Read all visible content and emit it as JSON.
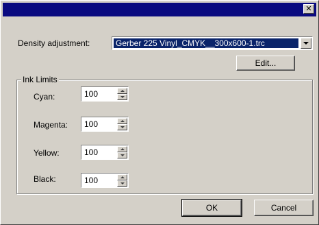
{
  "titlebar": {
    "close_glyph": "✕"
  },
  "density": {
    "label": "Density adjustment:",
    "value": "Gerber 225 Vinyl_CMYK__300x600-1.trc",
    "edit_label": "Edit..."
  },
  "ink_limits": {
    "title": "Ink Limits",
    "cyan": {
      "label": "Cyan:",
      "value": "100"
    },
    "magenta": {
      "label": "Magenta:",
      "value": "100"
    },
    "yellow": {
      "label": "Yellow:",
      "value": "100"
    },
    "black": {
      "label": "Black:",
      "value": "100"
    }
  },
  "buttons": {
    "ok": "OK",
    "cancel": "Cancel"
  },
  "colors": {
    "titlebar": "#0a0a80",
    "selection": "#0a246a",
    "face": "#d4d0c8"
  }
}
